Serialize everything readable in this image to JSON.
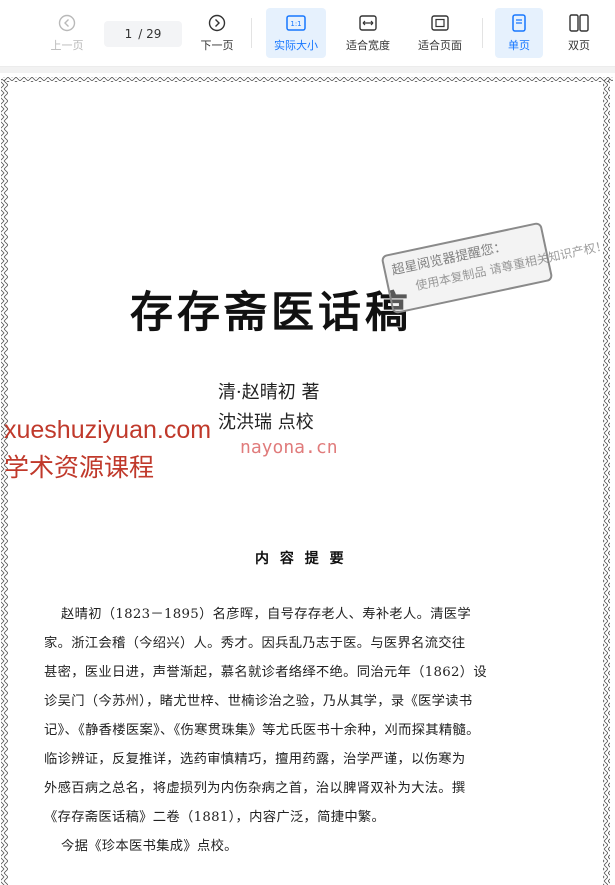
{
  "toolbar": {
    "prev_label": "上一页",
    "page_current": "1",
    "page_total": "/ 29",
    "next_label": "下一页",
    "actual_size_label": "实际大小",
    "fit_width_label": "适合宽度",
    "fit_page_label": "适合页面",
    "single_page_label": "单页",
    "double_page_label": "双页",
    "colors": {
      "accent": "#1677ff",
      "active_bg": "#e6f1fd",
      "disabled": "#b9b9b9"
    }
  },
  "document": {
    "title": "存存斋医话稿",
    "author_line1": "清·赵晴初  著",
    "author_line2": "沈洪瑞    点校",
    "section_heading": "内 容 提 要",
    "summary_lines": [
      "赵晴初（1823－1895）名彦晖，自号存存老人、寿补老人。清医学",
      "家。浙江会稽（今绍兴）人。秀才。因兵乱乃志于医。与医界名流交往",
      "甚密，医业日进，声誉渐起，慕名就诊者络绎不绝。同治元年（1862）设",
      "诊吴门（今苏州），睹尤世梓、世楠诊治之验，乃从其学，录《医学读书",
      "记》、《静香楼医案》、《伤寒贯珠集》等尤氏医书十余种，刈而探其精髓。",
      "临诊辨证，反复推详，选药审慎精巧，擅用药露，治学严谨，以伤寒为",
      "外感百病之总名，将虚损列为内伤杂病之首，治以脾肾双补为大法。撰",
      "《存存斋医话稿》二卷（1881），内容广泛，简捷中繁。",
      "今据《珍本医书集成》点校。"
    ]
  },
  "watermarks": {
    "stamp_line1": "超星阅览器提醒您：",
    "stamp_line2": "使用本复制品 请尊重相关知识产权！",
    "site_en": "xueshuziyuan.com",
    "site_cn": "学术资源课程",
    "site_small": "nayona.cn"
  }
}
